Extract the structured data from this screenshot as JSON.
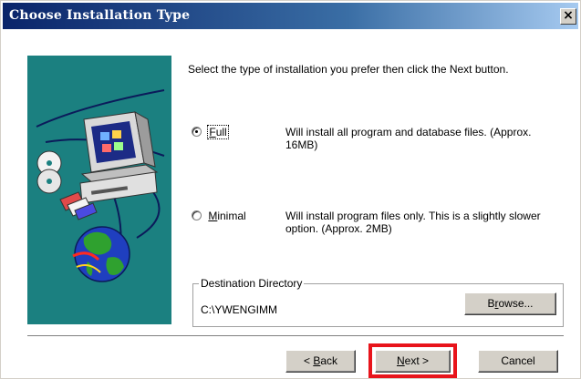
{
  "dialog": {
    "title": "Choose Installation Type",
    "close_glyph": "×"
  },
  "intro_text": "Select the type of installation you prefer then click the Next button.",
  "options": [
    {
      "label_pre": "",
      "label_mnemonic": "F",
      "label_post": "ull",
      "checked": true,
      "description": "Will install all program and database files. (Approx. 16MB)"
    },
    {
      "label_pre": "",
      "label_mnemonic": "M",
      "label_post": "inimal",
      "checked": false,
      "description": "Will install program files only. This is a slightly slower option. (Approx. 2MB)"
    }
  ],
  "destination": {
    "legend": "Destination Directory",
    "path": "C:\\YWENGIMM",
    "browse_pre": "B",
    "browse_mnemonic": "r",
    "browse_post": "owse..."
  },
  "buttons": {
    "back_pre": "< ",
    "back_mnemonic": "B",
    "back_post": "ack",
    "next_mnemonic": "N",
    "next_post": "ext >",
    "cancel_label": "Cancel"
  },
  "colors": {
    "title_gradient_start": "#0a246a",
    "side_panel": "#1b8080",
    "highlight_box": "#e8141b"
  },
  "icons": [
    "close-icon",
    "computer-monitor-icon",
    "cd-discs-icon",
    "floppy-disks-icon",
    "globe-icon"
  ]
}
